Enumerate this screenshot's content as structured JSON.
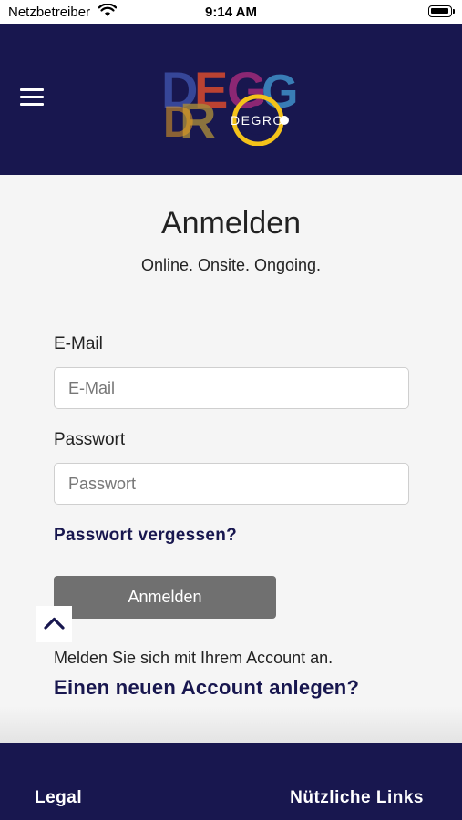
{
  "status_bar": {
    "carrier": "Netzbetreiber",
    "time": "9:14 AM",
    "icons": [
      "wifi-icon",
      "battery-icon"
    ]
  },
  "header": {
    "menu_icon": "hamburger-menu-icon",
    "logo_text": "DEGRO",
    "background_color": "#18174f"
  },
  "main": {
    "title": "Anmelden",
    "subtitle": "Online. Onsite. Ongoing.",
    "email": {
      "label": "E-Mail",
      "placeholder": "E-Mail",
      "value": ""
    },
    "password": {
      "label": "Passwort",
      "placeholder": "Passwort",
      "value": ""
    },
    "forgot_password": "Passwort vergessen?",
    "login_button": "Anmelden",
    "info_text": "Melden Sie sich mit Ihrem Account an.",
    "register_link": "Einen neuen Account anlegen?",
    "scroll_top_icon": "chevron-up-icon"
  },
  "footer": {
    "legal": "Legal",
    "useful_links": "Nützliche Links"
  },
  "colors": {
    "brand": "#18174f",
    "button": "#707070",
    "background": "#f5f5f5"
  }
}
